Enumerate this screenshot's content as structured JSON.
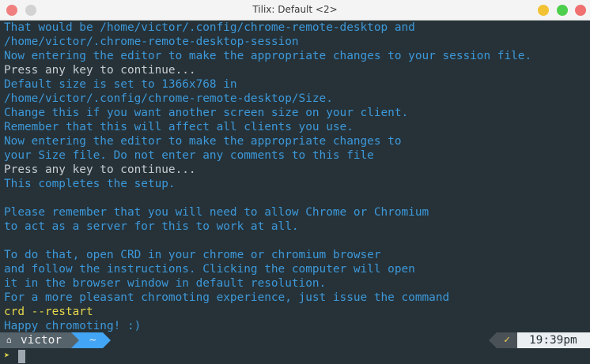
{
  "window": {
    "title": "Tilix: Default <2>"
  },
  "terminal": {
    "lines": [
      {
        "text": "That would be /home/victor/.config/chrome-remote-desktop and",
        "style": "output"
      },
      {
        "text": "/home/victor/.chrome-remote-desktop-session",
        "style": "output"
      },
      {
        "text": "Now entering the editor to make the appropriate changes to your session file.",
        "style": "output"
      },
      {
        "text": "Press any key to continue...",
        "style": "plain"
      },
      {
        "text": "Default size is set to 1366x768 in",
        "style": "output"
      },
      {
        "text": "/home/victor/.config/chrome-remote-desktop/Size.",
        "style": "output"
      },
      {
        "text": "Change this if you want another screen size on your client.",
        "style": "output"
      },
      {
        "text": "Remember that this will affect all clients you use.",
        "style": "output"
      },
      {
        "text": "Now entering the editor to make the appropriate changes to",
        "style": "output"
      },
      {
        "text": "your Size file. Do not enter any comments to this file",
        "style": "output"
      },
      {
        "text": "Press any key to continue...",
        "style": "plain"
      },
      {
        "text": "This completes the setup.",
        "style": "output"
      },
      {
        "text": "",
        "style": "output"
      },
      {
        "text": "Please remember that you will need to allow Chrome or Chromium",
        "style": "output"
      },
      {
        "text": "to act as a server for this to work at all.",
        "style": "output"
      },
      {
        "text": "",
        "style": "output"
      },
      {
        "text": "To do that, open CRD in your chrome or chromium browser",
        "style": "output"
      },
      {
        "text": "and follow the instructions. Clicking the computer will open",
        "style": "output"
      },
      {
        "text": "it in the browser window in default resolution.",
        "style": "output"
      },
      {
        "text": "For a more pleasant chromoting experience, just issue the command",
        "style": "output"
      },
      {
        "text": "crd --restart",
        "style": "cmd"
      },
      {
        "text": "Happy chromoting! :)",
        "style": "output"
      }
    ],
    "prompt": {
      "home_icon": "⌂",
      "user": "victor",
      "dir": "~",
      "status_icon": "✓",
      "time": "19:39pm",
      "input_symbol": "➤"
    }
  },
  "icons": {
    "home": "home-icon",
    "check": "check-icon",
    "chevron": "chevron-right-icon"
  },
  "colors": {
    "background": "#263238",
    "output_text": "#3d98d9",
    "plain_text": "#c7ccd1",
    "command_text": "#e8d84d",
    "user_segment": "#57636b",
    "dir_segment": "#42a5f5",
    "time_segment": "#eceff1"
  }
}
